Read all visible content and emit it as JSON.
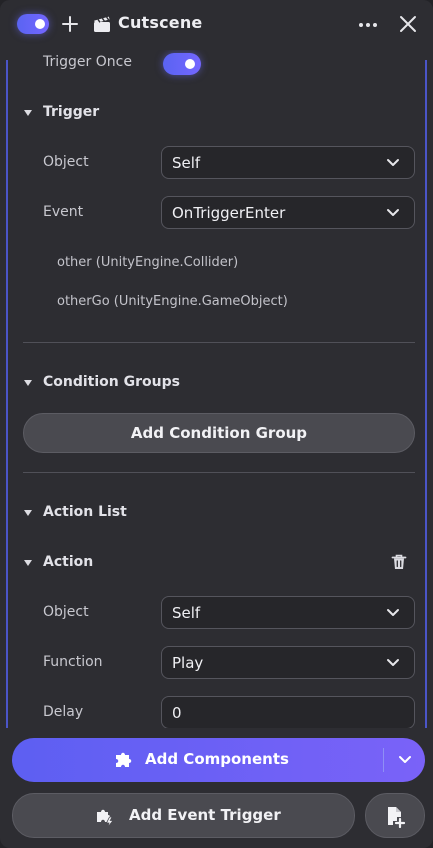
{
  "header": {
    "title": "Cutscene",
    "enabled": true,
    "icons": [
      "toggle",
      "plus-icon",
      "clapperboard-icon",
      "more-icon",
      "close-icon"
    ]
  },
  "trigger_once": {
    "label": "Trigger Once",
    "enabled": true
  },
  "trigger": {
    "heading": "Trigger",
    "object_label": "Object",
    "object_value": "Self",
    "event_label": "Event",
    "event_value": "OnTriggerEnter",
    "params": [
      "other (UnityEngine.Collider)",
      "otherGo (UnityEngine.GameObject)"
    ]
  },
  "condition_groups": {
    "heading": "Condition Groups",
    "add_button": "Add Condition Group"
  },
  "action_list": {
    "heading": "Action List",
    "action": {
      "heading": "Action",
      "object_label": "Object",
      "object_value": "Self",
      "function_label": "Function",
      "function_value": "Play",
      "delay_label": "Delay",
      "delay_value": "0"
    }
  },
  "footer": {
    "add_components": "Add Components",
    "add_event_trigger": "Add Event Trigger"
  },
  "colors": {
    "accent": "#6a63f6",
    "panel": "#2d2d32",
    "button": "#4a4a50"
  }
}
